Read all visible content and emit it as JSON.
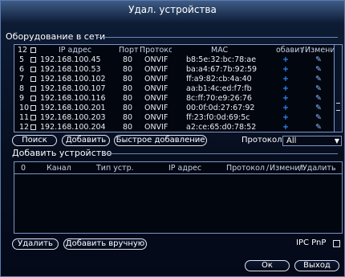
{
  "window": {
    "title": "Удал. устройства"
  },
  "network": {
    "section_label": "Оборудование в сети",
    "count": "12",
    "columns": {
      "ip": "IP адрес",
      "port": "Порт",
      "protocol": "Протокол",
      "mac": "MAC",
      "add": "обавит",
      "edit": "Изменит"
    },
    "rows": [
      {
        "num": "5",
        "ip": "192.168.100.45",
        "port": "80",
        "protocol": "ONVIF",
        "mac": "b8:5e:32:bc:78:ae"
      },
      {
        "num": "6",
        "ip": "192.168.100.53",
        "port": "80",
        "protocol": "ONVIF",
        "mac": "ba:a4:67:7b:92:59"
      },
      {
        "num": "7",
        "ip": "192.168.100.102",
        "port": "80",
        "protocol": "ONVIF",
        "mac": "ff:a9:82:cb:4a:40"
      },
      {
        "num": "8",
        "ip": "192.168.100.107",
        "port": "80",
        "protocol": "ONVIF",
        "mac": "aa:b1:4c:ed:f7:fb"
      },
      {
        "num": "9",
        "ip": "192.168.100.116",
        "port": "80",
        "protocol": "ONVIF",
        "mac": "8c:ff:70:e9:26:76"
      },
      {
        "num": "10",
        "ip": "192.168.100.201",
        "port": "80",
        "protocol": "ONVIF",
        "mac": "00:0f:0d:27:67:92"
      },
      {
        "num": "11",
        "ip": "192.168.100.203",
        "port": "80",
        "protocol": "ONVIF",
        "mac": "ff:23:f0:0d:69:5c"
      },
      {
        "num": "12",
        "ip": "192.168.100.204",
        "port": "80",
        "protocol": "ONVIF",
        "mac": "a2:ce:65:d0:78:52"
      }
    ]
  },
  "toolbar": {
    "search_label": "Поиск",
    "add_label": "Добавить",
    "quick_add_label": "Быстрое добавление",
    "protocol_label": "Протокол",
    "protocol_value": "All"
  },
  "added": {
    "section_label": "Добавить устройство",
    "columns": {
      "count": "0",
      "channel": "Канал",
      "device_type": "Тип устр.",
      "ip": "IP адрес",
      "protocol": "Протокол",
      "edit": "Изменит",
      "delete": "Удалить"
    }
  },
  "footer": {
    "delete_label": "Удалить",
    "manual_add_label": "Добавить вручную",
    "ipc_pnp_label": "IPC PnP",
    "ok_label": "Ок",
    "exit_label": "Выход"
  },
  "icons": {
    "add": "plus-icon",
    "edit": "pencil-icon"
  },
  "colors": {
    "accent": "#2f8cff",
    "border": "#7a95c8"
  }
}
